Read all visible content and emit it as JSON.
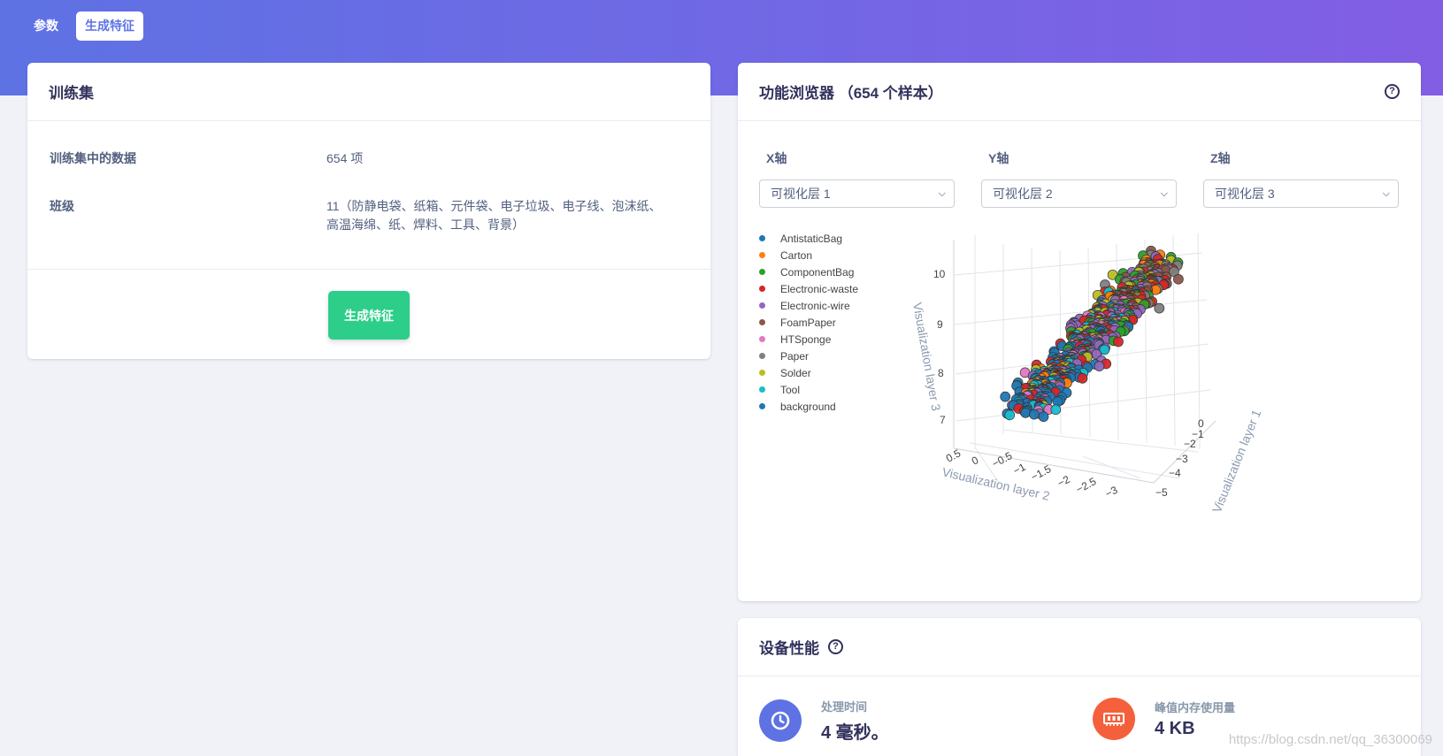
{
  "nav": {
    "tabs": [
      {
        "label": "参数",
        "active": false
      },
      {
        "label": "生成特征",
        "active": true
      }
    ]
  },
  "training": {
    "title": "训练集",
    "rows": [
      {
        "key": "训练集中的数据",
        "value": "654 项"
      },
      {
        "key": "班级",
        "value": "11（防静电袋、纸箱、元件袋、电子垃圾、电子线、泡沫纸、高温海绵、纸、焊料、工具、背景）"
      }
    ],
    "button_label": "生成特征"
  },
  "explorer": {
    "title": "功能浏览器 （654 个样本）",
    "help_icon": "question-circle-icon",
    "axes": [
      {
        "label": "X轴",
        "selected": "可视化层 1"
      },
      {
        "label": "Y轴",
        "selected": "可视化层 2"
      },
      {
        "label": "Z轴",
        "selected": "可视化层 3"
      }
    ]
  },
  "chart_data": {
    "type": "scatter",
    "dimensions": 3,
    "xlabel": "Visualization layer 2",
    "ylabel": "Visualization layer 1",
    "zlabel": "Visualization layer 3",
    "x_ticks": [
      "0.5",
      "0",
      "−0.5",
      "−1",
      "−1.5",
      "−2",
      "−2.5",
      "−3"
    ],
    "y_ticks": [
      "0",
      "−1",
      "−2",
      "−3",
      "−4",
      "−5"
    ],
    "z_ticks": [
      "10",
      "9",
      "8",
      "7"
    ],
    "xlim": [
      0.5,
      -3
    ],
    "ylim": [
      0,
      -5
    ],
    "zlim": [
      7,
      10.5
    ],
    "total_points": 654,
    "series": [
      {
        "name": "AntistaticBag",
        "color": "#1f77b4"
      },
      {
        "name": "Carton",
        "color": "#ff7f0e"
      },
      {
        "name": "ComponentBag",
        "color": "#2ca02c"
      },
      {
        "name": "Electronic-waste",
        "color": "#d62728"
      },
      {
        "name": "Electronic-wire",
        "color": "#9467bd"
      },
      {
        "name": "FoamPaper",
        "color": "#8c564b"
      },
      {
        "name": "HTSponge",
        "color": "#e377c2"
      },
      {
        "name": "Paper",
        "color": "#7f7f7f"
      },
      {
        "name": "Solder",
        "color": "#bcbd22"
      },
      {
        "name": "Tool",
        "color": "#17becf"
      },
      {
        "name": "background",
        "color": "#1f77b4"
      }
    ]
  },
  "perf": {
    "title": "设备性能",
    "help_icon": "question-circle-icon",
    "items": [
      {
        "label": "处理时间",
        "value": "4 毫秒。",
        "icon": "clock-icon",
        "color": "#5e72e4"
      },
      {
        "label": "峰值内存使用量",
        "value": "4 KB",
        "icon": "memory-icon",
        "color": "#f5603c"
      }
    ]
  },
  "watermark": "https://blog.csdn.net/qq_36300069"
}
